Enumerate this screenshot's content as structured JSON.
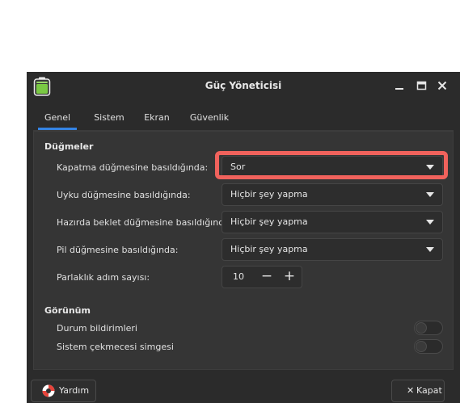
{
  "window": {
    "title": "Güç Yöneticisi"
  },
  "tabs": [
    {
      "label": "Genel",
      "active": true
    },
    {
      "label": "Sistem",
      "active": false
    },
    {
      "label": "Ekran",
      "active": false
    },
    {
      "label": "Güvenlik",
      "active": false
    }
  ],
  "buttons_section": {
    "heading": "Düğmeler",
    "rows": [
      {
        "label": "Kapatma düğmesine basıldığında:",
        "value": "Sor"
      },
      {
        "label": "Uyku düğmesine basıldığında:",
        "value": "Hiçbir şey yapma"
      },
      {
        "label": "Hazırda beklet düğmesine basıldığında:",
        "value": "Hiçbir şey yapma"
      },
      {
        "label": "Pil düğmesine basıldığında:",
        "value": "Hiçbir şey yapma"
      }
    ],
    "brightness": {
      "label": "Parlaklık adım sayısı:",
      "value": "10",
      "minus": "−",
      "plus": "+"
    }
  },
  "appearance_section": {
    "heading": "Görünüm",
    "rows": [
      {
        "label": "Durum bildirimleri",
        "on": false
      },
      {
        "label": "Sistem çekmecesi simgesi",
        "on": false
      }
    ]
  },
  "footer": {
    "help_label": "Yardım",
    "close_label": "Kapat",
    "close_glyph": "✕"
  },
  "colors": {
    "accent": "#3584e4",
    "highlight": "#f0625c",
    "battery_green": "#7ac943"
  },
  "icons": {
    "app": "battery-icon",
    "help": "lifebuoy-icon"
  }
}
